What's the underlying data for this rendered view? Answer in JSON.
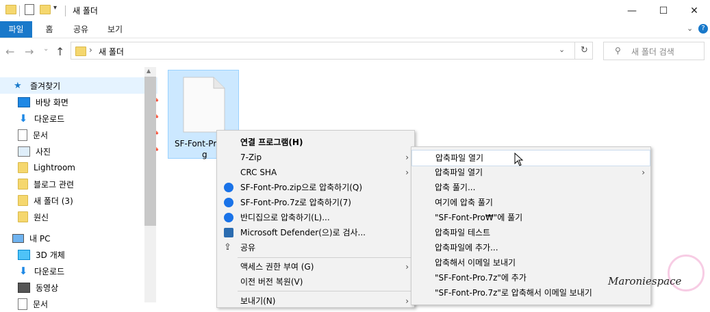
{
  "window": {
    "title": "새 폴더",
    "minimize_icon": "—",
    "maximize_icon": "☐",
    "close_icon": "✕"
  },
  "ribbon": {
    "file_tab": "파일",
    "tabs": [
      "홈",
      "공유",
      "보기"
    ]
  },
  "address": {
    "path": "새 폴더",
    "search_placeholder": "새 폴더 검색"
  },
  "sidebar": {
    "items": [
      {
        "label": "즐겨찾기",
        "icon": "star-icon"
      },
      {
        "label": "바탕 화면",
        "icon": "desktop-icon",
        "pinned": true
      },
      {
        "label": "다운로드",
        "icon": "download-icon",
        "pinned": true
      },
      {
        "label": "문서",
        "icon": "document-icon",
        "pinned": true
      },
      {
        "label": "사진",
        "icon": "picture-icon",
        "pinned": true
      },
      {
        "label": "Lightroom",
        "icon": "folder-icon"
      },
      {
        "label": "블로그 관련",
        "icon": "folder-icon"
      },
      {
        "label": "새 폴더 (3)",
        "icon": "folder-icon"
      },
      {
        "label": "원신",
        "icon": "folder-icon"
      },
      {
        "label": "내 PC",
        "icon": "pc-icon"
      },
      {
        "label": "3D 개체",
        "icon": "3d-objects-icon"
      },
      {
        "label": "다운로드",
        "icon": "download-icon"
      },
      {
        "label": "동영상",
        "icon": "video-icon"
      },
      {
        "label": "문서",
        "icon": "document-icon"
      }
    ]
  },
  "file": {
    "name_line1": "SF-Font-Pro",
    "name_line2": "g"
  },
  "context_menu": {
    "items": [
      {
        "label": "연결 프로그램(H)",
        "bold": true
      },
      {
        "label": "7-Zip",
        "submenu": true
      },
      {
        "label": "CRC SHA",
        "submenu": true
      },
      {
        "label": "SF-Font-Pro.zip으로 압축하기(Q)",
        "icon": "bandizip-icon"
      },
      {
        "label": "SF-Font-Pro.7z로 압축하기(7)",
        "icon": "bandizip-icon"
      },
      {
        "label": "반디집으로 압축하기(L)...",
        "icon": "bandizip-icon"
      },
      {
        "label": "Microsoft Defender(으)로 검사...",
        "icon": "defender-icon"
      },
      {
        "label": "공유",
        "icon": "share-icon"
      },
      {
        "label": "액세스 권한 부여 (G)",
        "submenu": true
      },
      {
        "label": "이전 버전 복원(V)"
      },
      {
        "label": "보내기(N)",
        "submenu": true
      }
    ]
  },
  "submenu_7zip": {
    "items": [
      {
        "label": "압축파일 열기"
      },
      {
        "label": "압축파일 열기",
        "submenu": true
      },
      {
        "label": "압축 풀기..."
      },
      {
        "label": "여기에 압축 풀기"
      },
      {
        "label": "\"SF-Font-Pro₩\"에 풀기"
      },
      {
        "label": "압축파일 테스트"
      },
      {
        "label": "압축파일에 추가..."
      },
      {
        "label": "압축해서 이메일 보내기"
      },
      {
        "label": "\"SF-Font-Pro.7z\"에 추가"
      },
      {
        "label": "\"SF-Font-Pro.7z\"로 압축해서 이메일 보내기"
      }
    ]
  },
  "watermark": {
    "text": "Maroniespace"
  },
  "colors": {
    "accent": "#1979ca",
    "selection": "#cce8ff",
    "folder": "#f5d76e"
  }
}
